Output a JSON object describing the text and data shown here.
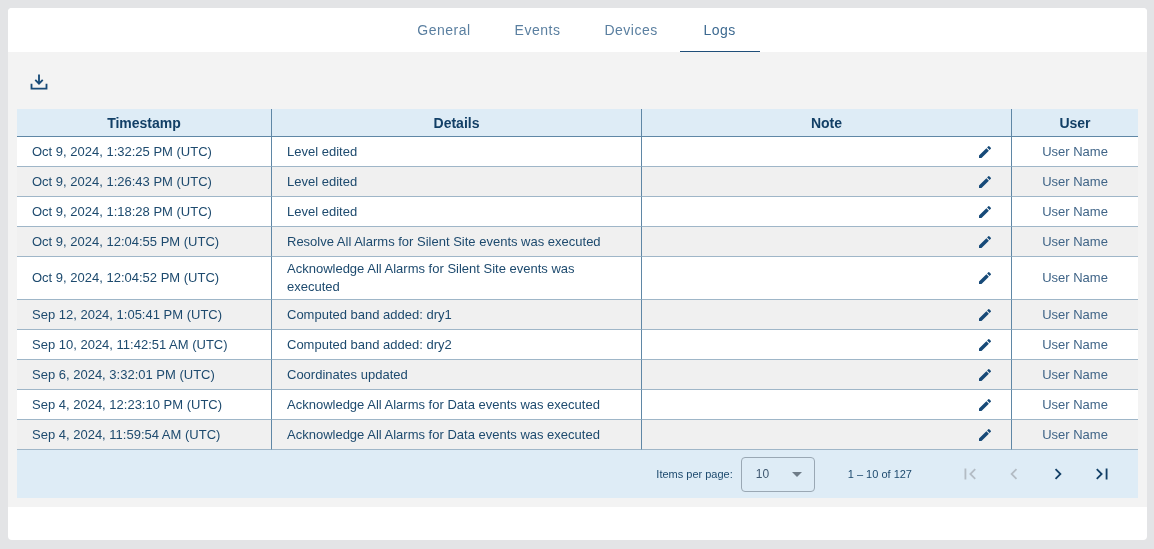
{
  "tabs": [
    {
      "label": "General",
      "selected": false
    },
    {
      "label": "Events",
      "selected": false
    },
    {
      "label": "Devices",
      "selected": false
    },
    {
      "label": "Logs",
      "selected": true
    }
  ],
  "table": {
    "columns": [
      "Timestamp",
      "Details",
      "Note",
      "User"
    ],
    "rows": [
      {
        "timestamp": "Oct 9, 2024, 1:32:25 PM (UTC)",
        "details": "Level edited",
        "user": "User Name"
      },
      {
        "timestamp": "Oct 9, 2024, 1:26:43 PM (UTC)",
        "details": "Level edited",
        "user": "User Name"
      },
      {
        "timestamp": "Oct 9, 2024, 1:18:28 PM (UTC)",
        "details": "Level edited",
        "user": "User Name"
      },
      {
        "timestamp": "Oct 9, 2024, 12:04:55 PM (UTC)",
        "details": "Resolve All Alarms for Silent Site events was executed",
        "user": "User Name"
      },
      {
        "timestamp": "Oct 9, 2024, 12:04:52 PM (UTC)",
        "details": "Acknowledge All Alarms for Silent Site events was executed",
        "user": "User Name"
      },
      {
        "timestamp": "Sep 12, 2024, 1:05:41 PM (UTC)",
        "details": "Computed band added: dry1",
        "user": "User Name"
      },
      {
        "timestamp": "Sep 10, 2024, 11:42:51 AM (UTC)",
        "details": "Computed band added: dry2",
        "user": "User Name"
      },
      {
        "timestamp": "Sep 6, 2024, 3:32:01 PM (UTC)",
        "details": "Coordinates updated",
        "user": "User Name"
      },
      {
        "timestamp": "Sep 4, 2024, 12:23:10 PM (UTC)",
        "details": "Acknowledge All Alarms for Data events was executed",
        "user": "User Name"
      },
      {
        "timestamp": "Sep 4, 2024, 11:59:54 AM (UTC)",
        "details": "Acknowledge All Alarms for Data events was executed",
        "user": "User Name"
      }
    ]
  },
  "paginator": {
    "items_per_page_label": "Items per page:",
    "page_size": "10",
    "range": "1 – 10 of 127",
    "buttons": [
      {
        "kind": "first",
        "disabled": true
      },
      {
        "kind": "prev",
        "disabled": true
      },
      {
        "kind": "next",
        "disabled": false
      },
      {
        "kind": "last",
        "disabled": false
      }
    ]
  }
}
